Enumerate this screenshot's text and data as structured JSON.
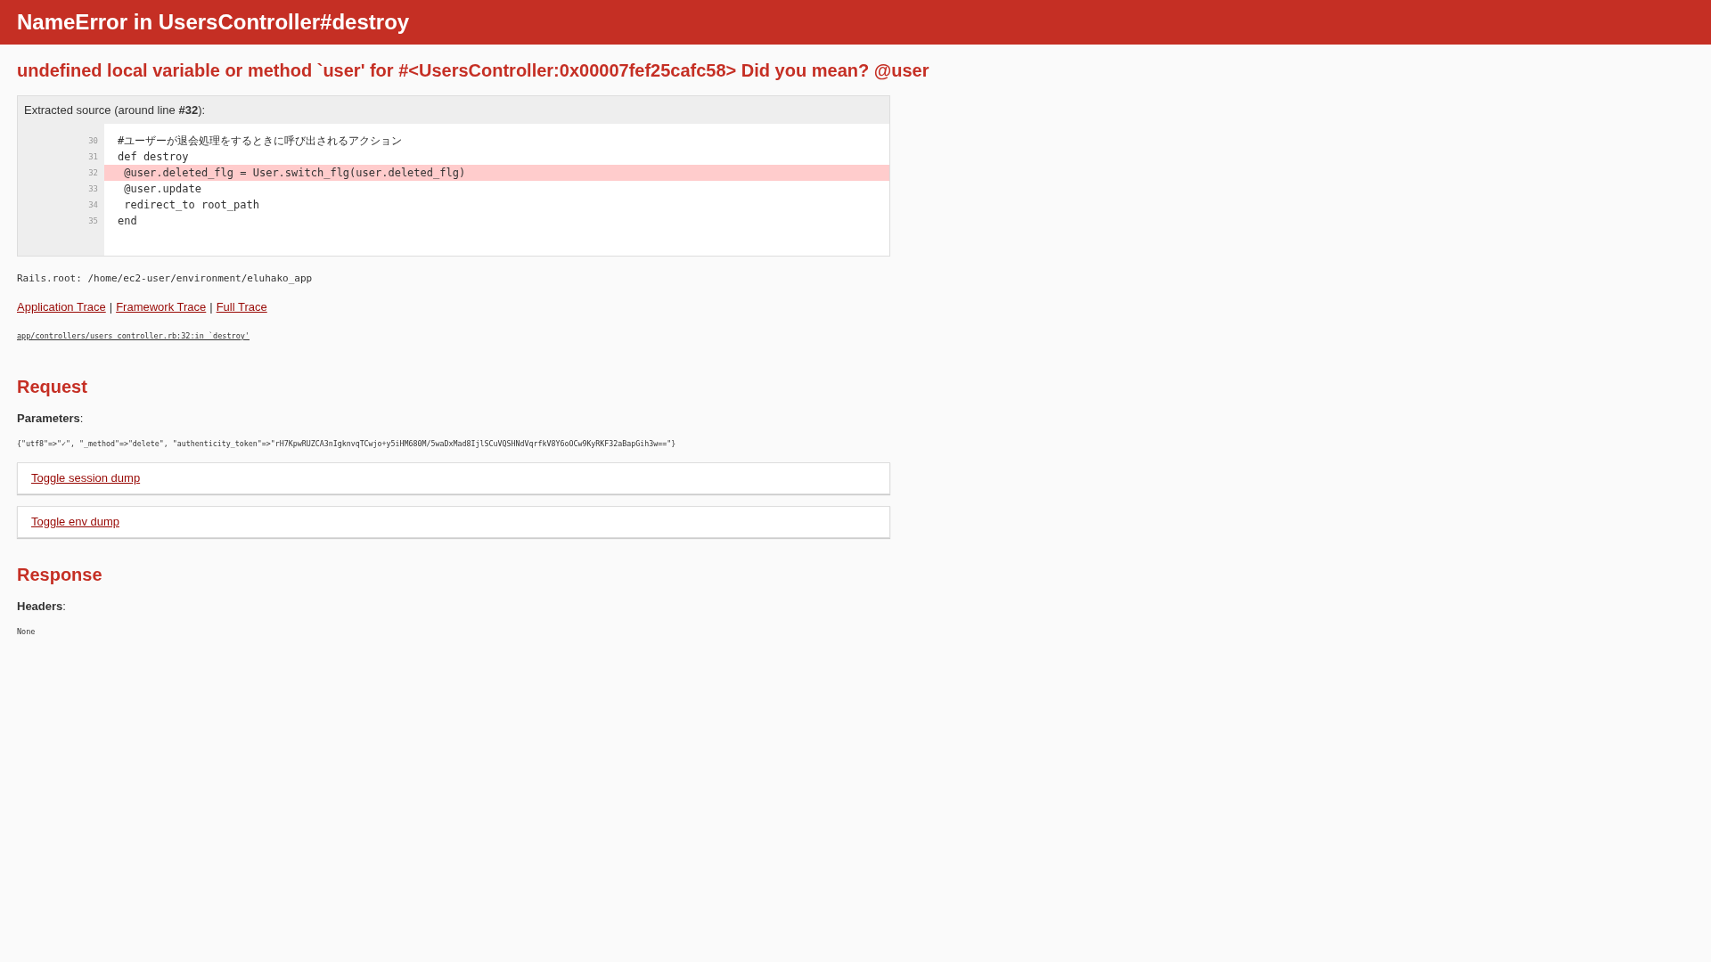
{
  "header": {
    "title": "NameError in UsersController#destroy"
  },
  "message": "undefined local variable or method `user' for #<UsersController:0x00007fef25cafc58> Did you mean? @user",
  "source": {
    "label": "Extracted source (around line **#32**):",
    "lines": [
      {
        "number": "30",
        "code": "#ユーザーが退会処理をするときに呼び出されるアクション",
        "highlighted": false
      },
      {
        "number": "31",
        "code": "def destroy",
        "highlighted": false
      },
      {
        "number": "32",
        "code": " @user.deleted_flg = User.switch_flg(user.deleted_flg)",
        "highlighted": true
      },
      {
        "number": "33",
        "code": " @user.update",
        "highlighted": false
      },
      {
        "number": "34",
        "code": " redirect_to root_path",
        "highlighted": false
      },
      {
        "number": "35",
        "code": "end",
        "highlighted": false
      }
    ]
  },
  "rails_root": "Rails.root: /home/ec2-user/environment/eluhako_app",
  "trace_links": [
    "Application Trace",
    "Framework Trace",
    "Full Trace"
  ],
  "trace_separator": "|",
  "trace_line": "app/controllers/users_controller.rb:32:in `destroy'",
  "request": {
    "heading": "Request",
    "parameters_label": "**Parameters**:",
    "parameters": "{\"utf8\"=>\"✓\", \"_method\"=>\"delete\", \"authenticity_token\"=>\"rH7KpwRUZCA3nIgknvqTCwjo+y5iHM680M/5waDxMad8IjlSCuVQSHNdVqrfkV8Y6oOCw9KyRKF32aBapGih3w==\"}",
    "toggles": [
      "Toggle session dump",
      "Toggle env dump"
    ]
  },
  "response": {
    "heading": "Response",
    "headers_label": "**Headers**:",
    "headers": "None"
  }
}
